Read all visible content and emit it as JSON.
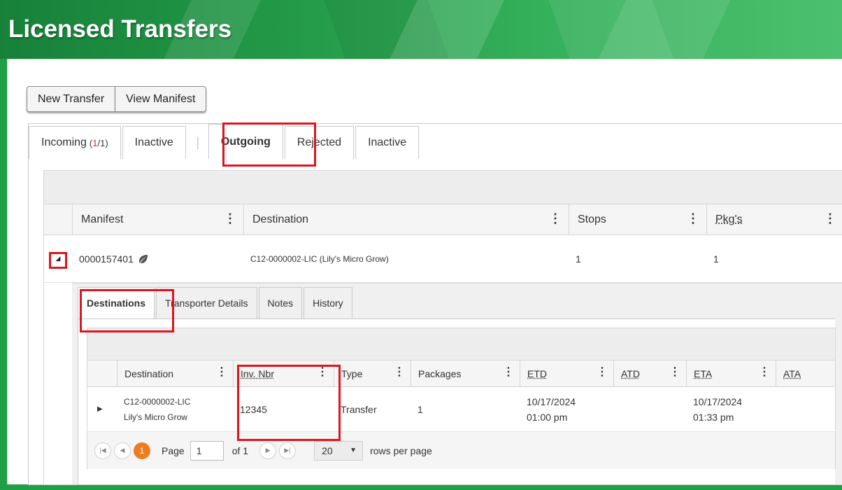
{
  "page": {
    "title": "Licensed Transfers"
  },
  "toolbar": {
    "new_transfer": "New Transfer",
    "view_manifest": "View Manifest"
  },
  "tabs": {
    "incoming": {
      "label": "Incoming",
      "count_open": "(",
      "count_a": "1",
      "count_b": "/1)"
    },
    "inactive_1": "Inactive",
    "separator": "|",
    "outgoing": "Outgoing",
    "rejected": "Rejected",
    "inactive_2": "Inactive"
  },
  "grid": {
    "columns": [
      "Manifest",
      "Destination",
      "Stops",
      "Pkg's"
    ],
    "row": {
      "manifest": "0000157401",
      "destination": "C12-0000002-LIC (Lily's Micro Grow)",
      "stops": "1",
      "packages": "1"
    }
  },
  "subtabs": [
    "Destinations",
    "Transporter Details",
    "Notes",
    "History"
  ],
  "sub_grid": {
    "columns": [
      "Destination",
      "Inv. Nbr",
      "Type",
      "Packages",
      "ETD",
      "ATD",
      "ETA",
      "ATA"
    ],
    "row": {
      "destination_license": "C12-0000002-LIC",
      "destination_name": "Lily's Micro Grow",
      "inv_nbr": "12345",
      "type": "Transfer",
      "packages": "1",
      "etd_date": "10/17/2024",
      "etd_time": "01:00 pm",
      "atd": "",
      "eta_date": "10/17/2024",
      "eta_time": "01:33 pm",
      "ata": ""
    }
  },
  "pager": {
    "current_page": "1",
    "page_label": "Page",
    "page_value": "1",
    "of_label": "of 1",
    "page_size": "20",
    "rows_label": "rows per page"
  },
  "colors": {
    "banner": "#1fa046",
    "highlight": "#e0141c",
    "pager_active": "#ec7e1f"
  }
}
